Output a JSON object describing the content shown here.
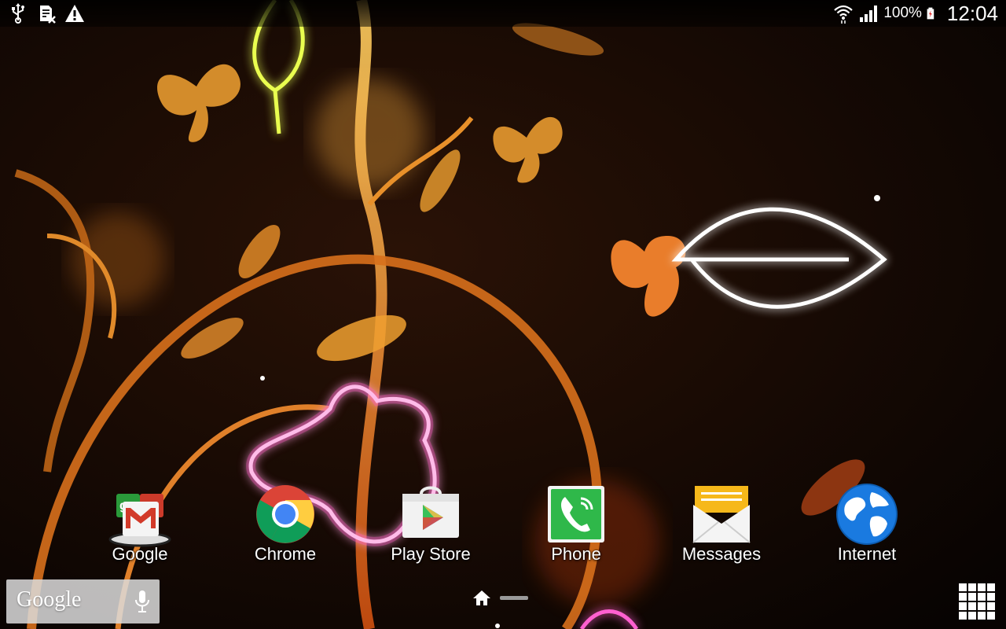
{
  "status_bar": {
    "left_icons": [
      "usb-icon",
      "sim-card-missing-icon",
      "warning-icon"
    ],
    "battery": "100%",
    "time": "12:04",
    "right_icons": [
      "wifi-icon",
      "signal-icon",
      "battery-icon"
    ]
  },
  "dock": {
    "apps": [
      {
        "label": "Google",
        "icon": "google-folder-icon"
      },
      {
        "label": "Chrome",
        "icon": "chrome-icon"
      },
      {
        "label": "Play Store",
        "icon": "play-store-icon"
      },
      {
        "label": "Phone",
        "icon": "phone-icon"
      },
      {
        "label": "Messages",
        "icon": "messages-icon"
      },
      {
        "label": "Internet",
        "icon": "internet-globe-icon"
      }
    ]
  },
  "search_widget": {
    "logo": "Google",
    "mic_icon": "microphone-icon"
  },
  "page_indicator": {
    "icon": "home-icon",
    "pages": 2,
    "current": 1
  },
  "app_drawer": {
    "icon": "apps-grid-icon"
  },
  "colors": {
    "wallpaper_base": "#0c0604",
    "accent_orange": "#f0a030",
    "glow_pink": "#ff40c0",
    "glow_yellow": "#ddff40"
  }
}
